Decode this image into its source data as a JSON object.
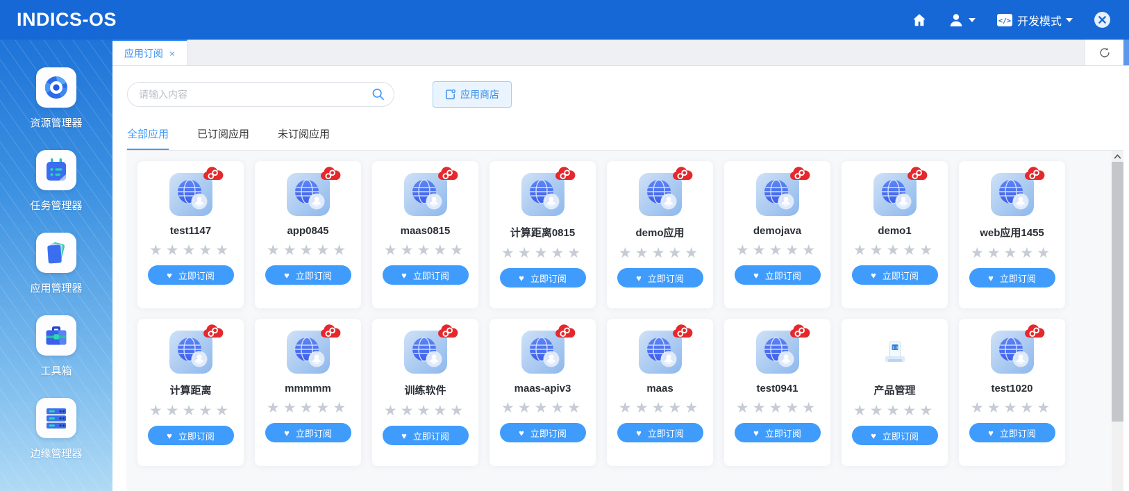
{
  "header": {
    "logo": "INDICS-OS",
    "dev_mode_label": "开发模式"
  },
  "sidebar": {
    "items": [
      {
        "label": "资源管理器",
        "icon": "resource-manager-icon"
      },
      {
        "label": "任务管理器",
        "icon": "task-manager-icon"
      },
      {
        "label": "应用管理器",
        "icon": "app-manager-icon"
      },
      {
        "label": "工具箱",
        "icon": "toolbox-icon"
      },
      {
        "label": "边缘管理器",
        "icon": "edge-manager-icon"
      }
    ]
  },
  "tab_bar": {
    "active_tab": "应用订阅",
    "close_symbol": "×"
  },
  "toolbar": {
    "search_placeholder": "请输入内容",
    "app_store_label": "应用商店"
  },
  "filter_tabs": [
    {
      "label": "全部应用",
      "active": true
    },
    {
      "label": "已订阅应用",
      "active": false
    },
    {
      "label": "未订阅应用",
      "active": false
    }
  ],
  "apps": {
    "subscribe_label": "立即订阅",
    "rating_max": 5,
    "cards": [
      {
        "name": "test1147",
        "icon": "globe",
        "cloud_badge": true,
        "rating": 0
      },
      {
        "name": "app0845",
        "icon": "globe",
        "cloud_badge": true,
        "rating": 0
      },
      {
        "name": "maas0815",
        "icon": "globe",
        "cloud_badge": true,
        "rating": 0
      },
      {
        "name": "计算距离0815",
        "icon": "globe",
        "cloud_badge": true,
        "rating": 0
      },
      {
        "name": "demo应用",
        "icon": "globe",
        "cloud_badge": true,
        "rating": 0
      },
      {
        "name": "demojava",
        "icon": "globe",
        "cloud_badge": true,
        "rating": 0
      },
      {
        "name": "demo1",
        "icon": "globe",
        "cloud_badge": true,
        "rating": 0
      },
      {
        "name": "web应用1455",
        "icon": "globe",
        "cloud_badge": true,
        "rating": 0
      },
      {
        "name": "计算距离",
        "icon": "globe",
        "cloud_badge": true,
        "rating": 0
      },
      {
        "name": "mmmmm",
        "icon": "globe",
        "cloud_badge": true,
        "rating": 0
      },
      {
        "name": "训练软件",
        "icon": "globe",
        "cloud_badge": true,
        "rating": 0
      },
      {
        "name": "maas-apiv3",
        "icon": "globe",
        "cloud_badge": true,
        "rating": 0
      },
      {
        "name": "maas",
        "icon": "globe",
        "cloud_badge": true,
        "rating": 0
      },
      {
        "name": "test0941",
        "icon": "globe",
        "cloud_badge": true,
        "rating": 0
      },
      {
        "name": "产品管理",
        "icon": "product",
        "cloud_badge": false,
        "rating": 0
      },
      {
        "name": "test1020",
        "icon": "globe",
        "cloud_badge": true,
        "rating": 0
      }
    ]
  },
  "colors": {
    "header_blue": "#1568d6",
    "accent_blue": "#3f9cfc",
    "tab_active_blue": "#3a8ef0",
    "badge_red": "#e5282c",
    "star_gray": "#c6cbd4"
  }
}
